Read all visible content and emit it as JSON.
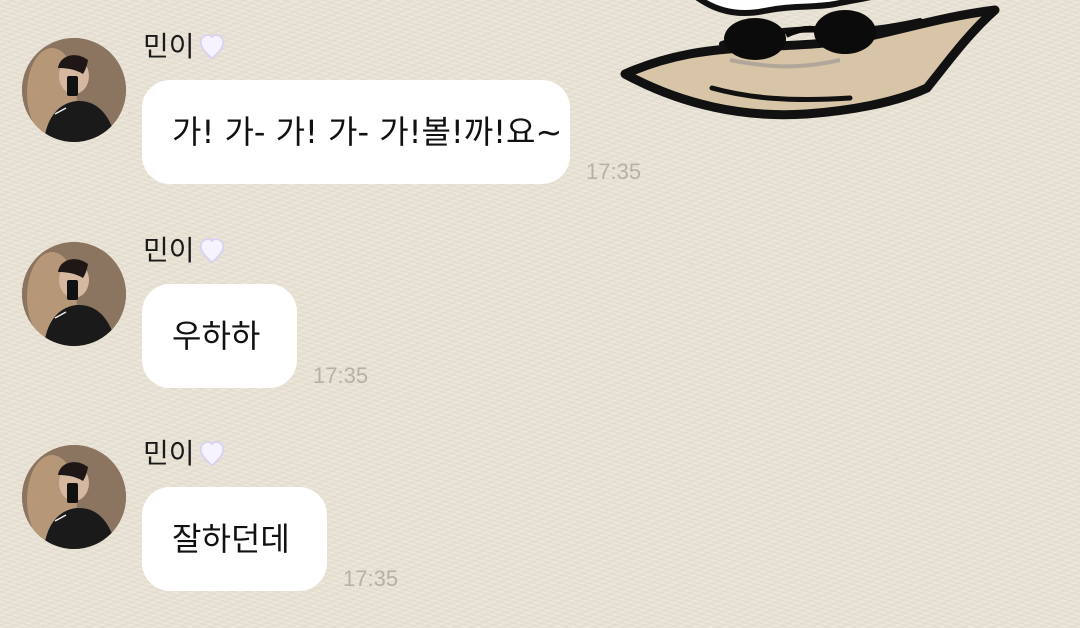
{
  "chat": {
    "messages": [
      {
        "sender": "민이",
        "text": "가! 가- 가! 가- 가!볼!까!요~",
        "time": "17:35"
      },
      {
        "sender": "민이",
        "text": "우하하",
        "time": "17:35"
      },
      {
        "sender": "민이",
        "text": "잘하던데",
        "time": "17:35"
      }
    ]
  },
  "colors": {
    "background": "#e8e2d3",
    "bubble": "#ffffff",
    "timestamp": "#b6b0a5",
    "heart": "#d9d2f0"
  },
  "icons": {
    "heart": "white-heart-icon",
    "sticker": "illustrated-sticker-icon"
  }
}
